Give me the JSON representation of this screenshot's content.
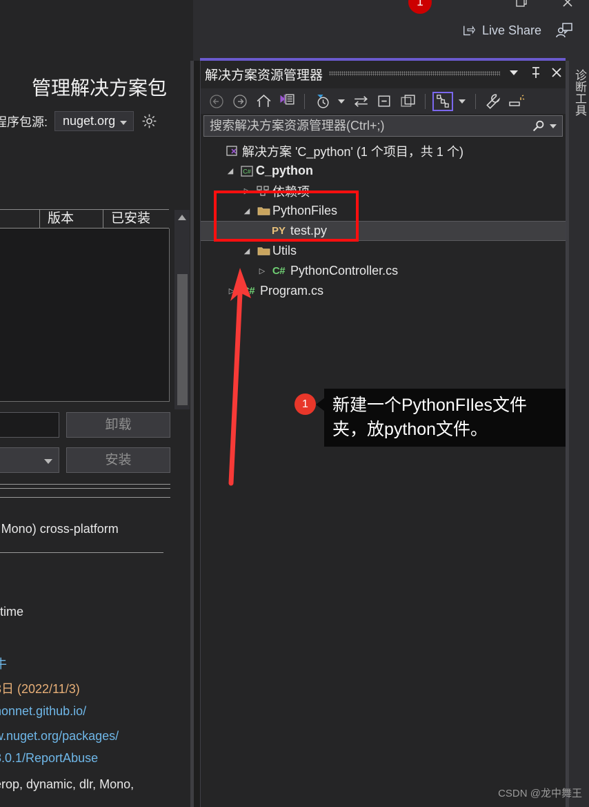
{
  "window": {
    "badge_count": "1",
    "live_share_label": "Live Share",
    "restore_icon": "restore-icon",
    "close_icon": "close-icon"
  },
  "nuget_panel": {
    "title": "管理解决方案包",
    "source_label": "程序包源:",
    "source_value": "nuget.org",
    "settings_icon": "gear-icon",
    "table_headers": [
      "",
      "版本",
      "已安装"
    ],
    "uninstall_label": "卸载",
    "install_label": "安装",
    "details": [
      "| Mono) cross-platform",
      "time",
      "牛",
      "3日 (2022/11/3)",
      "honnet.github.io/",
      "w.nuget.org/packages/",
      "3.0.1/ReportAbuse",
      "erop, dynamic, dlr, Mono,"
    ]
  },
  "solution_explorer": {
    "title": "解决方案资源管理器",
    "dropdown_icon": "chevron-down-icon",
    "pin_icon": "pin-icon",
    "close_icon": "close-icon",
    "toolbar": [
      {
        "name": "back-icon",
        "label": "←"
      },
      {
        "name": "forward-icon",
        "label": "→"
      },
      {
        "name": "home-icon",
        "label": "⌂"
      },
      {
        "name": "vs-document-icon",
        "label": ""
      },
      {
        "name": "pending-changes-filter-icon",
        "label": ""
      },
      {
        "name": "sync-with-active-document-icon",
        "label": ""
      },
      {
        "name": "collapse-all-icon",
        "label": ""
      },
      {
        "name": "properties-window-icon",
        "label": ""
      },
      {
        "name": "show-all-files-icon",
        "label": ""
      },
      {
        "name": "wrench-icon",
        "label": ""
      },
      {
        "name": "preview-selected-items-icon",
        "label": ""
      }
    ],
    "search_placeholder": "搜索解决方案资源管理器(Ctrl+;)",
    "search_value": "",
    "search_icon": "search-icon",
    "tree": [
      {
        "label": "解决方案 'C_python' (1 个项目，共 1 个)",
        "indent": 0,
        "twisty": "",
        "icon": "solution-icon",
        "bold": false,
        "selected": false
      },
      {
        "label": "C_python",
        "indent": 1,
        "twisty": "expanded",
        "icon": "csharp-project-icon",
        "bold": true,
        "selected": false
      },
      {
        "label": "依赖项",
        "indent": 2,
        "twisty": "collapsed",
        "icon": "dependencies-icon",
        "bold": false,
        "selected": false
      },
      {
        "label": "PythonFiles",
        "indent": 2,
        "twisty": "expanded",
        "icon": "folder-icon",
        "bold": false,
        "selected": false
      },
      {
        "label": "test.py",
        "indent": 3,
        "twisty": "",
        "icon": "python-file-icon",
        "bold": false,
        "selected": true
      },
      {
        "label": "Utils",
        "indent": 2,
        "twisty": "expanded",
        "icon": "folder-icon",
        "bold": false,
        "selected": false
      },
      {
        "label": "PythonController.cs",
        "indent": 3,
        "twisty": "collapsed",
        "icon": "csharp-file-icon",
        "bold": false,
        "selected": false
      },
      {
        "label": "Program.cs",
        "indent": 2,
        "twisty": "collapsed",
        "icon": "csharp-file-icon",
        "bold": false,
        "selected": false
      }
    ]
  },
  "annotation": {
    "number": "1",
    "text_line1": "新建一个PythonFIles文件",
    "text_line2": "夹，放python文件。",
    "arrow_color": "#f73a37",
    "box_color": "#ff0f0f"
  },
  "diagnostic_rail": {
    "label": "诊断工具"
  },
  "watermark": "CSDN @龙中舞王"
}
